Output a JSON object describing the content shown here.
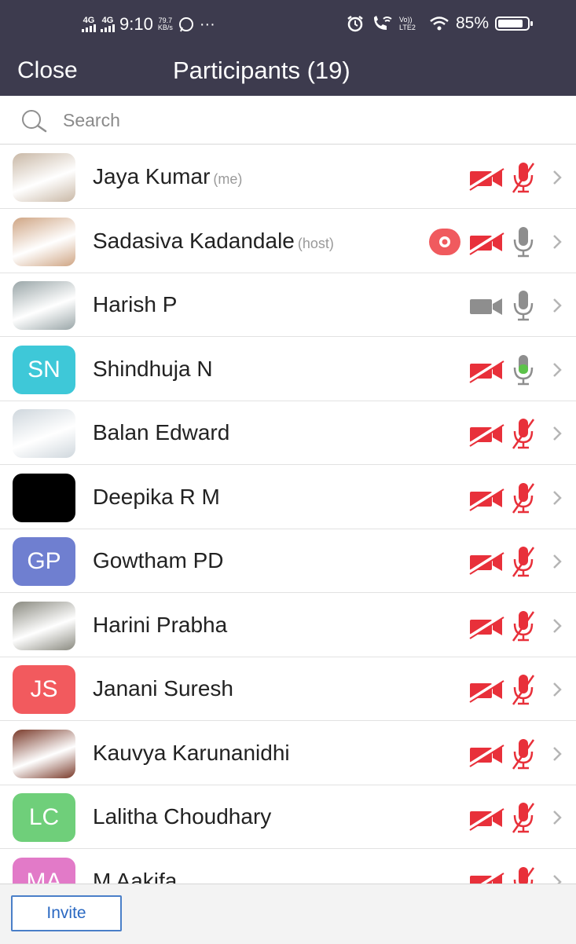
{
  "status_bar": {
    "network_1": "4G",
    "network_2": "4G",
    "time": "9:10",
    "speed_value": "79.7",
    "speed_unit": "KB/s",
    "dots": "···",
    "volte_label": "Vo)) LTE2",
    "battery_percent": "85%",
    "battery_level": 0.85,
    "icons": [
      "whatsapp-icon",
      "alarm-icon",
      "wifi-call-icon",
      "wifi-icon",
      "battery-icon"
    ]
  },
  "header": {
    "close_label": "Close",
    "title": "Participants (19)"
  },
  "search": {
    "placeholder": "Search"
  },
  "colors": {
    "header_bg": "#3d3b4e",
    "muted_red": "#e8303a",
    "unmuted_gray": "#8e8e8e",
    "speaking_green": "#5dc34a",
    "invite_blue": "#2a68c2"
  },
  "participants": [
    {
      "name": "Jaya Kumar",
      "tag": "(me)",
      "avatar_type": "photo",
      "avatar_initials": "",
      "avatar_color": "#c9b8a6",
      "video": "off",
      "audio": "muted",
      "recording": false
    },
    {
      "name": "Sadasiva Kadandale",
      "tag": "(host)",
      "avatar_type": "photo",
      "avatar_initials": "",
      "avatar_color": "#cfa584",
      "video": "off",
      "audio": "on",
      "recording": true
    },
    {
      "name": "Harish P",
      "tag": "",
      "avatar_type": "photo",
      "avatar_initials": "",
      "avatar_color": "#9aa6a8",
      "video": "on",
      "audio": "on",
      "recording": false
    },
    {
      "name": "Shindhuja N",
      "tag": "",
      "avatar_type": "initials",
      "avatar_initials": "SN",
      "avatar_color": "#3ec8d8",
      "video": "off",
      "audio": "speaking",
      "recording": false
    },
    {
      "name": "Balan Edward",
      "tag": "",
      "avatar_type": "photo",
      "avatar_initials": "",
      "avatar_color": "#cfd7dd",
      "video": "off",
      "audio": "muted",
      "recording": false
    },
    {
      "name": "Deepika R M",
      "tag": "",
      "avatar_type": "photo",
      "avatar_initials": "",
      "avatar_color": "#000000",
      "video": "off",
      "audio": "muted",
      "recording": false
    },
    {
      "name": "Gowtham PD",
      "tag": "",
      "avatar_type": "initials",
      "avatar_initials": "GP",
      "avatar_color": "#6f7fd0",
      "video": "off",
      "audio": "muted",
      "recording": false
    },
    {
      "name": "Harini Prabha",
      "tag": "",
      "avatar_type": "photo",
      "avatar_initials": "",
      "avatar_color": "#8a8a80",
      "video": "off",
      "audio": "muted",
      "recording": false
    },
    {
      "name": "Janani Suresh",
      "tag": "",
      "avatar_type": "initials",
      "avatar_initials": "JS",
      "avatar_color": "#f25a5e",
      "video": "off",
      "audio": "muted",
      "recording": false
    },
    {
      "name": "Kauvya Karunanidhi",
      "tag": "",
      "avatar_type": "photo",
      "avatar_initials": "",
      "avatar_color": "#7a3a2a",
      "video": "off",
      "audio": "muted",
      "recording": false
    },
    {
      "name": "Lalitha Choudhary",
      "tag": "",
      "avatar_type": "initials",
      "avatar_initials": "LC",
      "avatar_color": "#6fcf7a",
      "video": "off",
      "audio": "muted",
      "recording": false
    },
    {
      "name": "M Aakifa",
      "tag": "",
      "avatar_type": "initials",
      "avatar_initials": "MA",
      "avatar_color": "#e27ac8",
      "video": "off",
      "audio": "muted",
      "recording": false
    }
  ],
  "footer": {
    "invite_label": "Invite"
  }
}
